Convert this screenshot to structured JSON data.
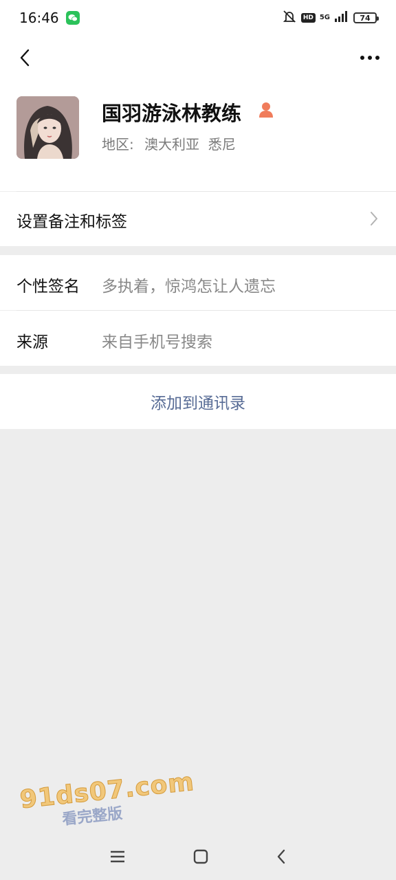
{
  "status_bar": {
    "time": "16:46",
    "hd": "HD",
    "network": "5G",
    "battery": "74"
  },
  "profile": {
    "name": "国羽游泳林教练",
    "region_label": "地区:",
    "region_value": "澳大利亚  悉尼"
  },
  "rows": {
    "remark_label": "设置备注和标签",
    "signature_label": "个性签名",
    "signature_value": "多执着，惊鸿怎让人遗忘",
    "source_label": "来源",
    "source_value": "来自手机号搜索"
  },
  "actions": {
    "add_contact": "添加到通讯录"
  },
  "watermark": {
    "main": "91ds07.com",
    "sub": "看完整版"
  },
  "colors": {
    "link": "#576b95",
    "wechat_green": "#2bc25a",
    "gender_icon": "#f07c5b"
  }
}
